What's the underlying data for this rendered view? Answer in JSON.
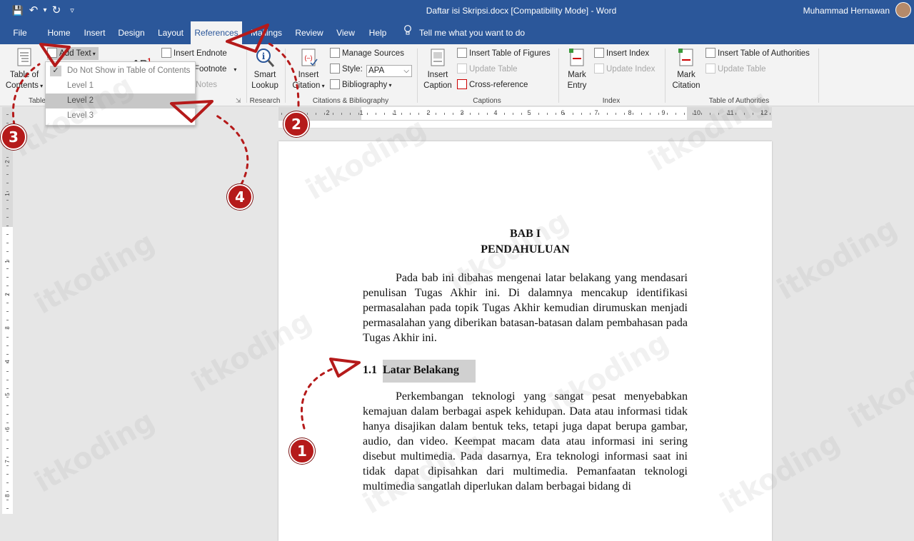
{
  "titlebar": {
    "doc_title": "Daftar isi Skripsi.docx [Compatibility Mode]  -  Word",
    "user_name": "Muhammad Hernawan",
    "qat": {
      "save": "💾",
      "undo": "↶",
      "undo_arrow": "▾",
      "redo": "↻",
      "customize": "▿"
    }
  },
  "tabs": [
    "File",
    "Home",
    "Insert",
    "Design",
    "Layout",
    "References",
    "Mailings",
    "Review",
    "View",
    "Help"
  ],
  "active_tab": "References",
  "tell_me": "Tell me what you want to do",
  "ribbon": {
    "toc": {
      "label1": "Table of",
      "label2": "Contents",
      "group": "Table",
      "add_text": "Add Text",
      "footnote_group_fragment": "Notes"
    },
    "footnotes": {
      "insert_endnote": "Insert Endnote",
      "footnote": "Footnote",
      "ab_icon": "AB",
      "superscript": "1"
    },
    "research": {
      "label1": "Smart",
      "label2": "Lookup",
      "group": "Research"
    },
    "citations": {
      "insert_citation1": "Insert",
      "insert_citation2": "Citation",
      "manage_sources": "Manage Sources",
      "style_label": "Style:",
      "style_value": "APA",
      "bibliography": "Bibliography",
      "group": "Citations & Bibliography"
    },
    "captions": {
      "insert_caption1": "Insert",
      "insert_caption2": "Caption",
      "insert_table_of_figures": "Insert Table of Figures",
      "update_table": "Update Table",
      "cross_reference": "Cross-reference",
      "group": "Captions"
    },
    "index": {
      "mark_entry1": "Mark",
      "mark_entry2": "Entry",
      "insert_index": "Insert Index",
      "update_index": "Update Index",
      "group": "Index"
    },
    "authorities": {
      "mark_citation1": "Mark",
      "mark_citation2": "Citation",
      "insert_toa": "Insert Table of Authorities",
      "update_table": "Update Table",
      "group": "Table of Authorities"
    }
  },
  "menu": {
    "items": [
      "Do Not Show in Table of Contents",
      "Level 1",
      "Level 2",
      "Level 3"
    ],
    "checked": "Do Not Show in Table of Contents",
    "highlighted": "Level 2"
  },
  "ruler": {
    "h_numbers": [
      "2",
      "1",
      "1",
      "2",
      "3",
      "4",
      "5",
      "6",
      "7",
      "8",
      "9",
      "10",
      "11",
      "12"
    ],
    "v_numbers": [
      "2",
      "1",
      "1",
      "2",
      "3",
      "4",
      "5",
      "6",
      "7",
      "8"
    ],
    "tab_selector": "L"
  },
  "document": {
    "chapter": "BAB I",
    "chapter_title": "PENDAHULUAN",
    "intro": "Pada bab ini dibahas mengenai latar belakang yang mendasari penulisan Tugas Akhir ini. Di dalamnya mencakup identifikasi permasalahan pada topik Tugas Akhir kemudian dirumuskan menjadi permasalahan yang diberikan batasan-batasan dalam pembahasan pada Tugas Akhir ini.",
    "heading_number": "1.1",
    "heading_text": "Latar Belakang",
    "body": "Perkembangan teknologi yang sangat pesat menyebabkan kemajuan dalam berbagai aspek kehidupan. Data atau informasi tidak hanya disajikan dalam bentuk teks, tetapi juga dapat berupa gambar, audio, dan video. Keempat macam data atau informasi ini sering disebut multimedia. Pada dasarnya, Era teknologi informasi saat ini tidak dapat dipisahkan dari multimedia. Pemanfaatan teknologi multimedia sangatlah diperlukan dalam berbagai bidang di"
  },
  "watermark": "itkoding",
  "annotations": [
    "1",
    "2",
    "3",
    "4"
  ],
  "colors": {
    "word_blue": "#2b579a",
    "annotation_red": "#b51a1a"
  }
}
